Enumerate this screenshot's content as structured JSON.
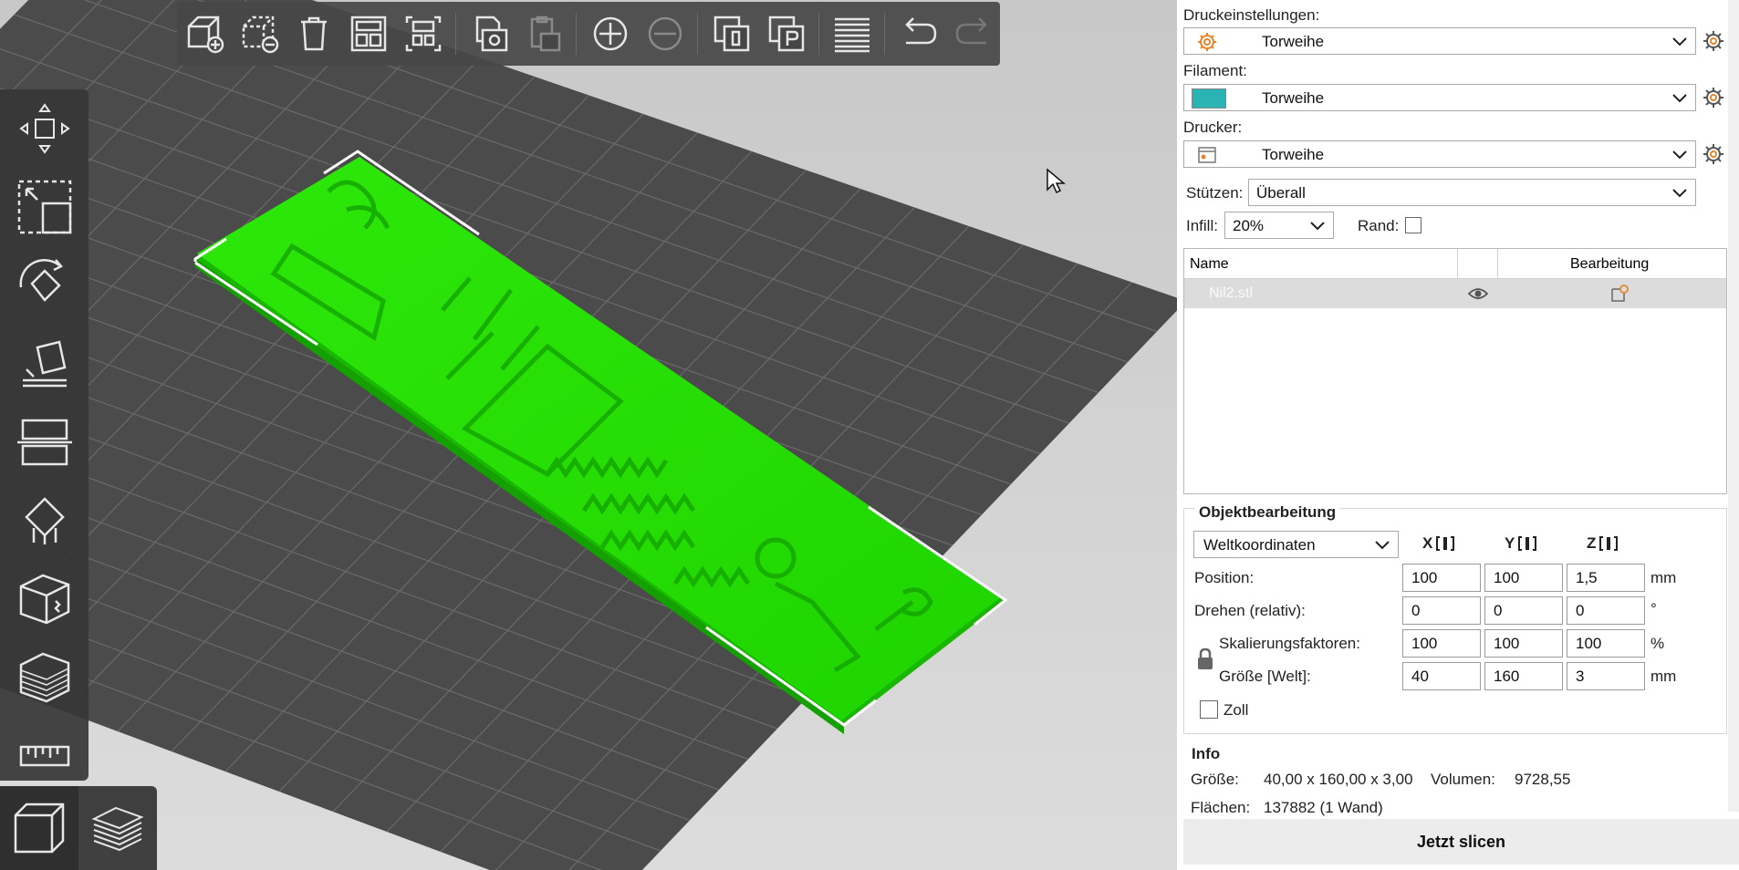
{
  "toolbar": {
    "items": [
      "add-object",
      "remove-object",
      "delete-all",
      "arrange",
      "split",
      "copy-export",
      "paste",
      "add-instance",
      "remove-instance",
      "split-to-objects",
      "split-to-parts",
      "layers-editing",
      "undo",
      "redo"
    ]
  },
  "sidebar_tools": [
    "move",
    "scale",
    "rotate",
    "place-on-face",
    "cut",
    "support-paint",
    "seam-paint",
    "variable-layer-height",
    "measure"
  ],
  "view_buttons": [
    "3d-view",
    "preview"
  ],
  "settings": {
    "print_label": "Druckeinstellungen:",
    "print_value": "Torweihe",
    "filament_label": "Filament:",
    "filament_value": "Torweihe",
    "filament_color": "#2ab3b3",
    "printer_label": "Drucker:",
    "printer_value": "Torweihe",
    "supports_label": "Stützen:",
    "supports_value": "Überall",
    "infill_label": "Infill:",
    "infill_value": "20%",
    "brim_label": "Rand:"
  },
  "object_list": {
    "col_name": "Name",
    "col_edit": "Bearbeitung",
    "rows": [
      {
        "name": "Nil2.stl"
      }
    ]
  },
  "object_manipulation": {
    "title": "Objektbearbeitung",
    "coord_mode": "Weltkoordinaten",
    "axis_x": "X",
    "axis_y": "Y",
    "axis_z": "Z",
    "position_label": "Position:",
    "position": [
      "100",
      "100",
      "1,5"
    ],
    "position_unit": "mm",
    "rotate_label": "Drehen (relativ):",
    "rotate": [
      "0",
      "0",
      "0"
    ],
    "rotate_unit": "°",
    "scale_label": "Skalierungsfaktoren:",
    "scale": [
      "100",
      "100",
      "100"
    ],
    "scale_unit": "%",
    "size_label": "Größe [Welt]:",
    "size": [
      "40",
      "160",
      "3"
    ],
    "size_unit": "mm",
    "inch_label": "Zoll"
  },
  "info": {
    "title": "Info",
    "size_label": "Größe:",
    "size_value": "40,00 x 160,00 x 3,00",
    "volume_label": "Volumen:",
    "volume_value": "9728,55",
    "facets_label": "Flächen:",
    "facets_value": "137882 (1 Wand)"
  },
  "slice_button": "Jetzt slicen",
  "colors": {
    "model": "#22dd00",
    "bed": "#4a4a4a",
    "accent": "#e8842a"
  }
}
